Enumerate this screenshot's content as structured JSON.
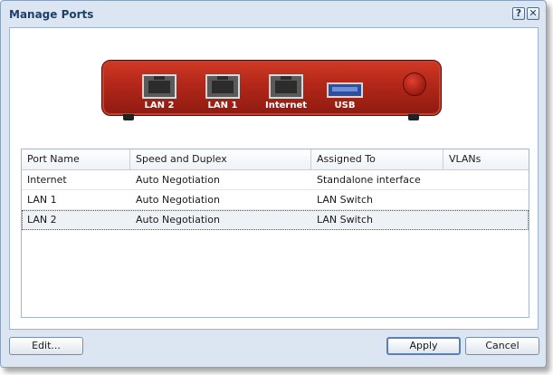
{
  "window": {
    "title": "Manage Ports",
    "help_label": "?",
    "close_label": "✕"
  },
  "device": {
    "ports": [
      {
        "label": "LAN 2",
        "kind": "ethernet"
      },
      {
        "label": "LAN 1",
        "kind": "ethernet"
      },
      {
        "label": "Internet",
        "kind": "ethernet"
      },
      {
        "label": "USB",
        "kind": "usb"
      }
    ],
    "colors": {
      "body": "#b5281a",
      "usb": "#2c4fa3"
    }
  },
  "table": {
    "columns": [
      "Port Name",
      "Speed and Duplex",
      "Assigned To",
      "VLANs"
    ],
    "rows": [
      [
        "Internet",
        "Auto Negotiation",
        "Standalone interface",
        ""
      ],
      [
        "LAN 1",
        "Auto Negotiation",
        "LAN Switch",
        ""
      ],
      [
        "LAN 2",
        "Auto Negotiation",
        "LAN Switch",
        ""
      ]
    ],
    "selected_row": 2
  },
  "buttons": {
    "edit": "Edit...",
    "apply": "Apply",
    "cancel": "Cancel"
  }
}
